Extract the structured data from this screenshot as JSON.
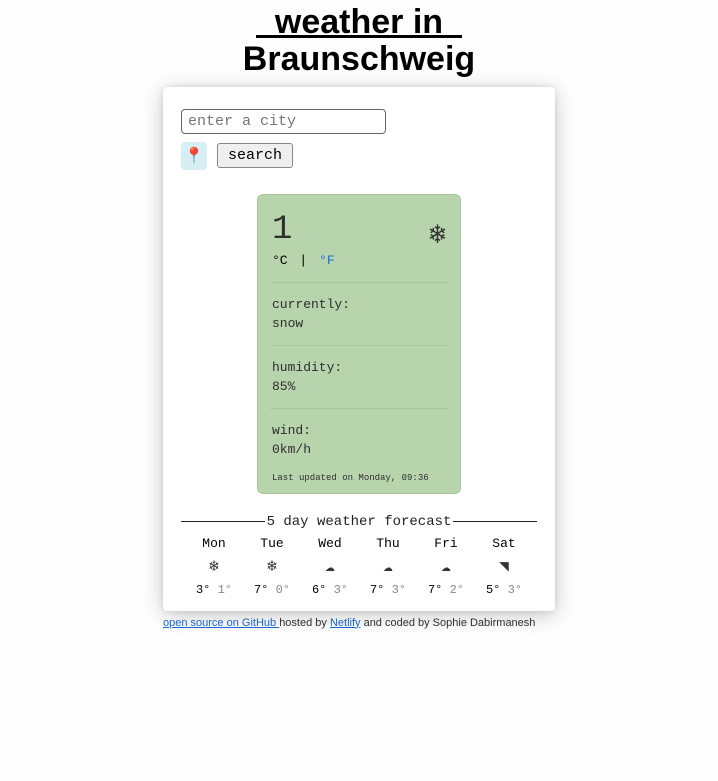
{
  "header": {
    "line1": "  weather in  ",
    "line2": "Braunschweig"
  },
  "search": {
    "placeholder": "enter a city",
    "value": "",
    "button_label": "search",
    "pin_icon": "📍"
  },
  "weather": {
    "temperature": "1",
    "unit_c": "°C",
    "unit_sep": "|",
    "unit_f": "°F",
    "icon": "❄",
    "currently_label": "currently:",
    "currently_value": "snow",
    "humidity_label": "humidity:",
    "humidity_value": "85%",
    "wind_label": "wind:",
    "wind_value": "0km/h",
    "last_updated": "Last updated on Monday, 09:36"
  },
  "forecast": {
    "title": "5 day weather forecast",
    "days": [
      {
        "name": "Mon",
        "icon": "❄",
        "hi": "3°",
        "lo": "1°"
      },
      {
        "name": "Tue",
        "icon": "❄",
        "hi": "7°",
        "lo": "0°"
      },
      {
        "name": "Wed",
        "icon": "☁",
        "hi": "6°",
        "lo": "3°"
      },
      {
        "name": "Thu",
        "icon": "☁",
        "hi": "7°",
        "lo": "3°"
      },
      {
        "name": "Fri",
        "icon": "☁",
        "hi": "7°",
        "lo": "2°"
      },
      {
        "name": "Sat",
        "icon": "◥",
        "hi": "5°",
        "lo": "3°"
      }
    ]
  },
  "footer": {
    "github_text": "open source on GitHub ",
    "hosted_text": "hosted by ",
    "netlify_text": "Netlify",
    "coded_text": " and coded by Sophie Dabirmanesh"
  }
}
